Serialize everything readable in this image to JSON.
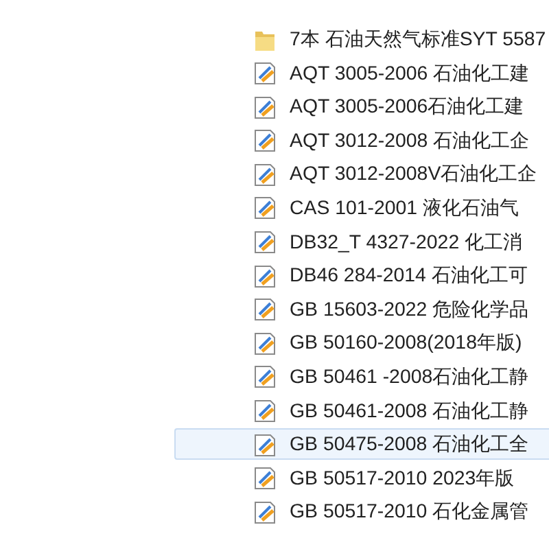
{
  "files": [
    {
      "kind": "folder",
      "name": "7本 石油天然气标准SYT 5587",
      "selected": false
    },
    {
      "kind": "document",
      "name": "AQT 3005-2006 石油化工建",
      "selected": false
    },
    {
      "kind": "document",
      "name": "AQT 3005-2006石油化工建",
      "selected": false
    },
    {
      "kind": "document",
      "name": "AQT 3012-2008 石油化工企",
      "selected": false
    },
    {
      "kind": "document",
      "name": "AQT 3012-2008V石油化工企",
      "selected": false
    },
    {
      "kind": "document",
      "name": "CAS 101-2001 液化石油气",
      "selected": false
    },
    {
      "kind": "document",
      "name": "DB32_T 4327-2022 化工消",
      "selected": false
    },
    {
      "kind": "document",
      "name": "DB46 284-2014 石油化工可",
      "selected": false
    },
    {
      "kind": "document",
      "name": "GB 15603-2022 危险化学品",
      "selected": false
    },
    {
      "kind": "document",
      "name": "GB 50160-2008(2018年版)",
      "selected": false
    },
    {
      "kind": "document",
      "name": "GB 50461 -2008石油化工静",
      "selected": false
    },
    {
      "kind": "document",
      "name": "GB 50461-2008 石油化工静",
      "selected": false
    },
    {
      "kind": "document",
      "name": "GB 50475-2008 石油化工全",
      "selected": true
    },
    {
      "kind": "document",
      "name": "GB 50517-2010 2023年版",
      "selected": false
    },
    {
      "kind": "document",
      "name": "GB 50517-2010 石化金属管",
      "selected": false
    }
  ]
}
